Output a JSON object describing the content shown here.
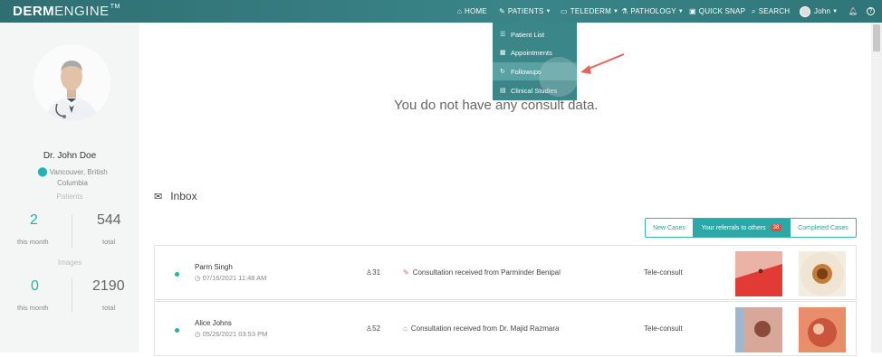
{
  "logo": {
    "bold": "DERM",
    "thin": "ENGINE",
    "mark": "TM"
  },
  "nav": {
    "home": "HOME",
    "patients": "PATIENTS",
    "telederm": "TELEDERM",
    "pathology": "PATHOLOGY",
    "quick_snap": "QUICK SNAP",
    "search": "SEARCH",
    "user": "John"
  },
  "patients_menu": [
    {
      "label": "Patient List",
      "icon": "list-icon"
    },
    {
      "label": "Appointments",
      "icon": "calendar-icon"
    },
    {
      "label": "Followups",
      "icon": "refresh-icon"
    },
    {
      "label": "Clinical Studies",
      "icon": "id-card-icon"
    }
  ],
  "profile": {
    "name": "Dr. John Doe",
    "location": "Vancouver, British Columbia"
  },
  "stats": {
    "patients_label": "Patients",
    "patients_month": "2",
    "patients_total": "544",
    "images_label": "Images",
    "images_month": "0",
    "images_total": "2190",
    "this_month": "this month",
    "total": "total"
  },
  "main": {
    "empty_message": "You do not have any consult data.",
    "inbox_title": "Inbox",
    "tabs": {
      "new_cases": "New Cases",
      "referrals": "Your referrals to others",
      "referrals_count": "38",
      "completed": "Completed Cases"
    },
    "rows": [
      {
        "name": "Parm Singh",
        "date": "07/16/2021 11:48 AM",
        "age": "31",
        "message": "Consultation received from Parminder Benipal",
        "type": "Tele-consult"
      },
      {
        "name": "Alice Johns",
        "date": "05/26/2021 03:53 PM",
        "age": "52",
        "message": "Consultation received from Dr. Majid Razmara",
        "type": "Tele-consult"
      }
    ]
  },
  "colors": {
    "accent": "#1bb5b5",
    "topbar": "#34797c",
    "badge": "#e14b3b",
    "annotation": "#e8625a"
  }
}
